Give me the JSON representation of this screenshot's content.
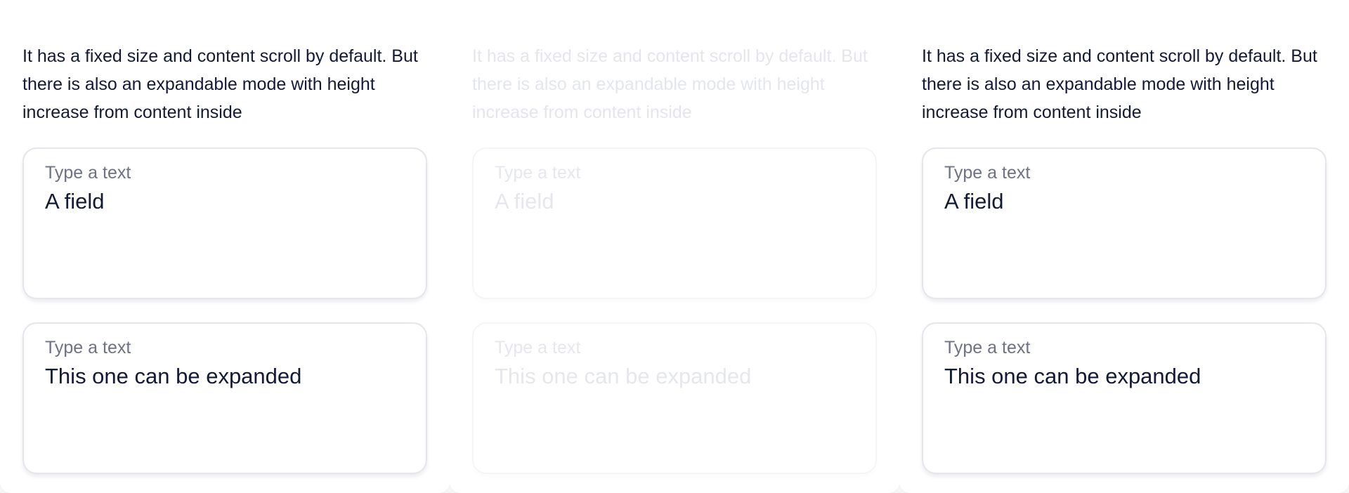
{
  "columns": [
    {
      "state": "default",
      "description": "It has a fixed size and content scroll by default. But there is also an expandable mode with height increase from content inside",
      "fields": [
        {
          "label": "Type a text",
          "value": "A field"
        },
        {
          "label": "Type a text",
          "value": "This one can be expanded"
        }
      ]
    },
    {
      "state": "disabled",
      "description": "It has a fixed size and content scroll by default. But there is also an expandable mode with height increase from content inside",
      "fields": [
        {
          "label": "Type a text",
          "value": "A field"
        },
        {
          "label": "Type a text",
          "value": "This one can be expanded"
        }
      ]
    },
    {
      "state": "default",
      "description": "It has a fixed size and content scroll by default. But there is also an expandable mode with height increase from content inside",
      "fields": [
        {
          "label": "Type a text",
          "value": "A field"
        },
        {
          "label": "Type a text",
          "value": "This one can be expanded"
        }
      ]
    }
  ],
  "colors": {
    "text_primary": "#121a36",
    "text_label": "#6d7284",
    "border": "#e4e6ec",
    "disabled_text": "#e6e7ec",
    "card_background": "#ffffff",
    "page_background": "#f4f5f7"
  }
}
